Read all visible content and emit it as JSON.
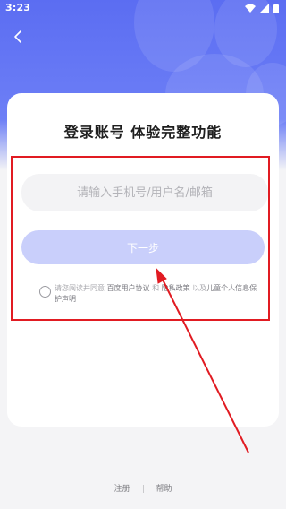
{
  "status_bar": {
    "time": "3:23",
    "icons": [
      "wifi-icon",
      "signal-icon",
      "battery-icon"
    ]
  },
  "header": {
    "back_icon": "chevron-left-icon"
  },
  "login_card": {
    "title": "登录账号 体验完整功能",
    "input_placeholder": "请输入手机号/用户名/邮箱",
    "input_value": "",
    "next_button": "下一步",
    "agreement": {
      "prefix": "请您阅读并同意",
      "user_agreement": "百度用户协议",
      "conj1": "和",
      "privacy_policy": "隐私政策",
      "conj2": "以及",
      "child_protection": "儿童个人信息保护声明"
    }
  },
  "footer": {
    "register": "注册",
    "help": "帮助"
  },
  "colors": {
    "header_gradient_top": "#5b6df2",
    "button_disabled": "#c9cffb",
    "annotation_red": "#e11b22"
  }
}
